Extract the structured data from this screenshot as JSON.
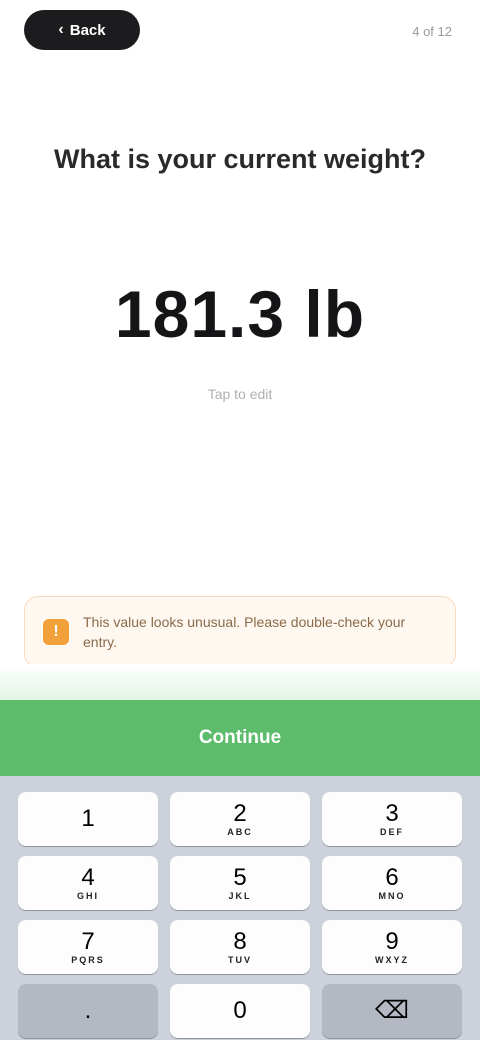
{
  "header": {
    "back_label": "Back",
    "step_label": "4 of 12"
  },
  "main": {
    "question": "What is your current weight?",
    "weight_value": "181.3 lb",
    "hint": "Tap to edit"
  },
  "warning": {
    "text": "This value looks unusual. Please double-check your entry."
  },
  "actions": {
    "continue_label": "Continue"
  },
  "keyboard": {
    "keys": [
      {
        "num": "1",
        "letters": ""
      },
      {
        "num": "2",
        "letters": "ABC"
      },
      {
        "num": "3",
        "letters": "DEF"
      },
      {
        "num": "4",
        "letters": "GHI"
      },
      {
        "num": "5",
        "letters": "JKL"
      },
      {
        "num": "6",
        "letters": "MNO"
      },
      {
        "num": "7",
        "letters": "PQRS"
      },
      {
        "num": "8",
        "letters": "TUV"
      },
      {
        "num": "9",
        "letters": "WXYZ"
      },
      {
        "num": ".",
        "letters": ""
      },
      {
        "num": "0",
        "letters": ""
      },
      {
        "num": "⌫",
        "letters": ""
      }
    ]
  },
  "colors": {
    "accent_green": "#5cbc6c",
    "warning_orange": "#f2a13a",
    "keyboard_bg": "#cdd1da"
  }
}
